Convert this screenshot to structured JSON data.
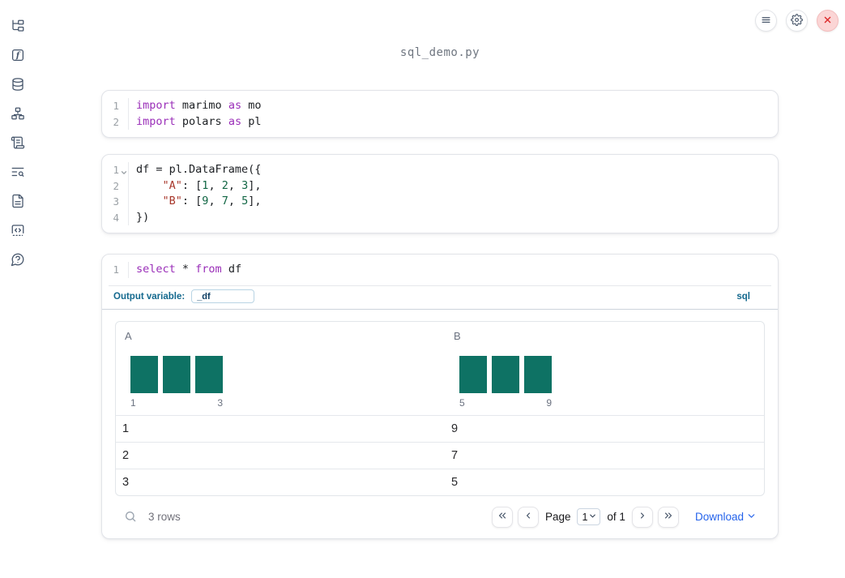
{
  "window": {
    "title": "sql_demo.py"
  },
  "topbar": {
    "buttons": [
      {
        "name": "menu",
        "icon": "menu-icon"
      },
      {
        "name": "settings",
        "icon": "gear-icon"
      },
      {
        "name": "close",
        "icon": "close-icon"
      }
    ]
  },
  "sidebar": {
    "icons": [
      "file-explorer-icon",
      "variables-icon",
      "data-sources-icon",
      "dependencies-icon",
      "logs-icon",
      "text-search-icon",
      "documentation-icon",
      "snippets-icon",
      "help-icon"
    ]
  },
  "cells": [
    {
      "id": "imports",
      "lines": [
        {
          "n": "1",
          "tokens": [
            {
              "t": "import",
              "c": "kw"
            },
            {
              "t": " marimo ",
              "c": "p"
            },
            {
              "t": "as",
              "c": "kw"
            },
            {
              "t": " mo",
              "c": "p"
            }
          ]
        },
        {
          "n": "2",
          "tokens": [
            {
              "t": "import",
              "c": "kw"
            },
            {
              "t": " polars ",
              "c": "p"
            },
            {
              "t": "as",
              "c": "kw"
            },
            {
              "t": " pl",
              "c": "p"
            }
          ]
        }
      ]
    },
    {
      "id": "dataframe",
      "lines": [
        {
          "n": "1",
          "fold": true,
          "tokens": [
            {
              "t": "df = pl.DataFrame({",
              "c": "p"
            }
          ]
        },
        {
          "n": "2",
          "tokens": [
            {
              "t": "    ",
              "c": "p"
            },
            {
              "t": "\"A\"",
              "c": "str"
            },
            {
              "t": ": [",
              "c": "p"
            },
            {
              "t": "1",
              "c": "num"
            },
            {
              "t": ", ",
              "c": "p"
            },
            {
              "t": "2",
              "c": "num"
            },
            {
              "t": ", ",
              "c": "p"
            },
            {
              "t": "3",
              "c": "num"
            },
            {
              "t": "],",
              "c": "p"
            }
          ]
        },
        {
          "n": "3",
          "tokens": [
            {
              "t": "    ",
              "c": "p"
            },
            {
              "t": "\"B\"",
              "c": "str"
            },
            {
              "t": ": [",
              "c": "p"
            },
            {
              "t": "9",
              "c": "num"
            },
            {
              "t": ", ",
              "c": "p"
            },
            {
              "t": "7",
              "c": "num"
            },
            {
              "t": ", ",
              "c": "p"
            },
            {
              "t": "5",
              "c": "num"
            },
            {
              "t": "],",
              "c": "p"
            }
          ]
        },
        {
          "n": "4",
          "tokens": [
            {
              "t": "})",
              "c": "p"
            }
          ]
        }
      ]
    },
    {
      "id": "sql",
      "lines": [
        {
          "n": "1",
          "tokens": [
            {
              "t": "select",
              "c": "kw"
            },
            {
              "t": " * ",
              "c": "p"
            },
            {
              "t": "from",
              "c": "kw"
            },
            {
              "t": " df",
              "c": "p"
            }
          ]
        }
      ]
    }
  ],
  "sql_meta": {
    "output_variable_label": "Output variable:",
    "output_variable_value": "_df",
    "language_badge": "sql"
  },
  "table": {
    "columns": [
      {
        "name": "A",
        "histogram": {
          "bar_counts": [
            1,
            1,
            1
          ],
          "min_label": "1",
          "max_label": "3"
        }
      },
      {
        "name": "B",
        "histogram": {
          "bar_counts": [
            1,
            1,
            1
          ],
          "min_label": "5",
          "max_label": "9"
        }
      }
    ],
    "rows": [
      [
        "1",
        "9"
      ],
      [
        "2",
        "7"
      ],
      [
        "3",
        "5"
      ]
    ]
  },
  "footer": {
    "row_count": "3 rows",
    "page_label": "Page",
    "page_value": "1",
    "of_label": "of 1",
    "download_label": "Download"
  },
  "colors": {
    "histogram_bar": "#0e7264",
    "keyword": "#9a2eb8",
    "string": "#a7362a",
    "number": "#116644",
    "sql_label_blue": "#14698e",
    "download_blue": "#2563eb",
    "close_red": "#dc2626"
  }
}
